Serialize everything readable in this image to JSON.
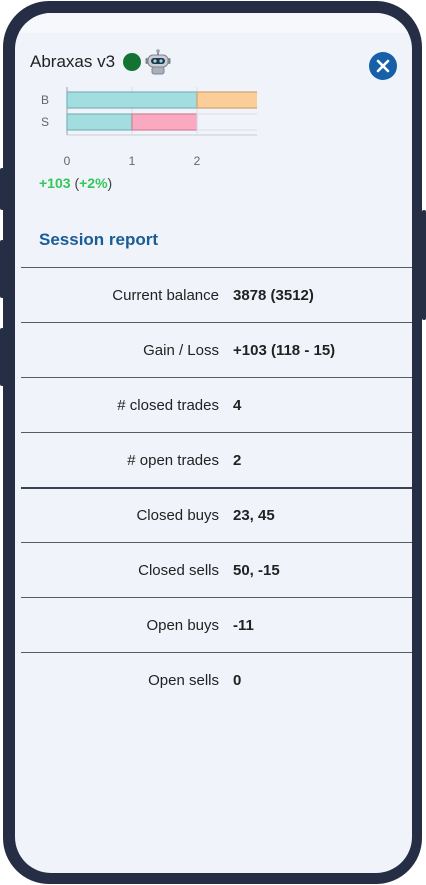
{
  "app": {
    "title": "Abraxas v3",
    "status_color": "#137333",
    "status_icon": "online-dot",
    "bot_icon": "robot-icon",
    "close_icon": "close-icon"
  },
  "chart_data": {
    "type": "bar",
    "stacked": true,
    "orientation": "horizontal",
    "categories": [
      "B",
      "S"
    ],
    "series": [
      {
        "color": "#a2dde0",
        "values": [
          2,
          1
        ]
      },
      {
        "color": "#fbcd98",
        "values": [
          1,
          0
        ]
      },
      {
        "color": "#f9a9c0",
        "values": [
          0,
          1
        ]
      }
    ],
    "xticks": [
      "0",
      "1",
      "2",
      "3"
    ],
    "xlim": [
      0,
      3
    ],
    "grid": true
  },
  "pnl": {
    "value": "+103",
    "percent": "+2%",
    "open_paren": "(",
    "close_paren": ")"
  },
  "report": {
    "title": "Session report",
    "rows": [
      {
        "label": "Current balance",
        "value": "3878 (3512)"
      },
      {
        "label": "Gain / Loss",
        "value": "+103 (118 - 15)"
      },
      {
        "label": "# closed trades",
        "value": "4"
      },
      {
        "label": "# open trades",
        "value": "2"
      },
      {
        "label": "Closed buys",
        "value": "23, 45"
      },
      {
        "label": "Closed sells",
        "value": "50, -15"
      },
      {
        "label": "Open buys",
        "value": "-11"
      },
      {
        "label": "Open sells",
        "value": "0"
      }
    ]
  }
}
